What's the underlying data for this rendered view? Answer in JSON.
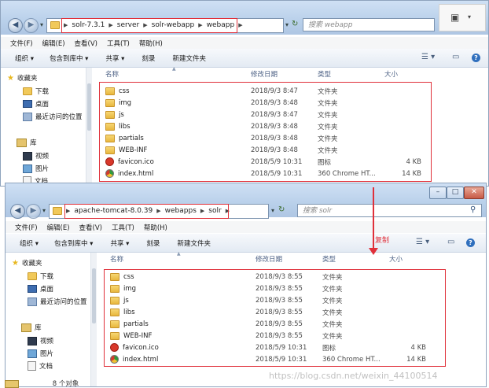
{
  "top_window": {
    "breadcrumb": [
      "solr-7.3.1",
      "server",
      "solr-webapp",
      "webapp"
    ],
    "search_placeholder": "搜索 webapp",
    "menu": [
      "文件(F)",
      "编辑(E)",
      "查看(V)",
      "工具(T)",
      "帮助(H)"
    ],
    "toolbar": [
      "组织 ▾",
      "包含到库中 ▾",
      "共享 ▾",
      "刻录",
      "新建文件夹"
    ],
    "nav": {
      "favorites": "收藏夹",
      "items": [
        "下载",
        "桌面",
        "最近访问的位置"
      ],
      "library": "库",
      "library_items": [
        "视频",
        "图片",
        "文档"
      ]
    },
    "columns": {
      "name": "名称",
      "date": "修改日期",
      "type": "类型",
      "size": "大小"
    },
    "files": [
      {
        "icon": "folder-icon",
        "name": "css",
        "date": "2018/9/3 8:47",
        "type": "文件夹",
        "size": ""
      },
      {
        "icon": "folder-icon",
        "name": "img",
        "date": "2018/9/3 8:48",
        "type": "文件夹",
        "size": ""
      },
      {
        "icon": "folder-icon",
        "name": "js",
        "date": "2018/9/3 8:47",
        "type": "文件夹",
        "size": ""
      },
      {
        "icon": "folder-icon",
        "name": "libs",
        "date": "2018/9/3 8:48",
        "type": "文件夹",
        "size": ""
      },
      {
        "icon": "folder-icon",
        "name": "partials",
        "date": "2018/9/3 8:48",
        "type": "文件夹",
        "size": ""
      },
      {
        "icon": "folder-icon",
        "name": "WEB-INF",
        "date": "2018/9/3 8:48",
        "type": "文件夹",
        "size": ""
      },
      {
        "icon": "favicon-icon",
        "name": "favicon.ico",
        "date": "2018/5/9 10:31",
        "type": "图标",
        "size": "4 KB"
      },
      {
        "icon": "html-icon",
        "name": "index.html",
        "date": "2018/5/9 10:31",
        "type": "360 Chrome HT...",
        "size": "14 KB"
      }
    ]
  },
  "bottom_window": {
    "breadcrumb": [
      "apache-tomcat-8.0.39",
      "webapps",
      "solr"
    ],
    "search_placeholder": "搜索 solr",
    "menu": [
      "文件(F)",
      "编辑(E)",
      "查看(V)",
      "工具(T)",
      "帮助(H)"
    ],
    "toolbar": [
      "组织 ▾",
      "包含到库中 ▾",
      "共享 ▾",
      "刻录",
      "新建文件夹"
    ],
    "nav": {
      "favorites": "收藏夹",
      "items": [
        "下载",
        "桌面",
        "最近访问的位置"
      ],
      "library": "库",
      "library_items": [
        "视频",
        "图片",
        "文档"
      ]
    },
    "columns": {
      "name": "名称",
      "date": "修改日期",
      "type": "类型",
      "size": "大小"
    },
    "files": [
      {
        "icon": "folder-icon",
        "name": "css",
        "date": "2018/9/3 8:55",
        "type": "文件夹",
        "size": ""
      },
      {
        "icon": "folder-icon",
        "name": "img",
        "date": "2018/9/3 8:55",
        "type": "文件夹",
        "size": ""
      },
      {
        "icon": "folder-icon",
        "name": "js",
        "date": "2018/9/3 8:55",
        "type": "文件夹",
        "size": ""
      },
      {
        "icon": "folder-icon",
        "name": "libs",
        "date": "2018/9/3 8:55",
        "type": "文件夹",
        "size": ""
      },
      {
        "icon": "folder-icon",
        "name": "partials",
        "date": "2018/9/3 8:55",
        "type": "文件夹",
        "size": ""
      },
      {
        "icon": "folder-icon",
        "name": "WEB-INF",
        "date": "2018/9/3 8:55",
        "type": "文件夹",
        "size": ""
      },
      {
        "icon": "favicon-icon",
        "name": "favicon.ico",
        "date": "2018/5/9 10:31",
        "type": "图标",
        "size": "4 KB"
      },
      {
        "icon": "html-icon",
        "name": "index.html",
        "date": "2018/5/9 10:31",
        "type": "360 Chrome HT...",
        "size": "14 KB"
      }
    ]
  },
  "annotation": {
    "copy_label": "复制",
    "color": "#e0303a"
  },
  "status": {
    "count": "8 个对象"
  },
  "watermark": "https://blog.csdn.net/weixin_44100514"
}
